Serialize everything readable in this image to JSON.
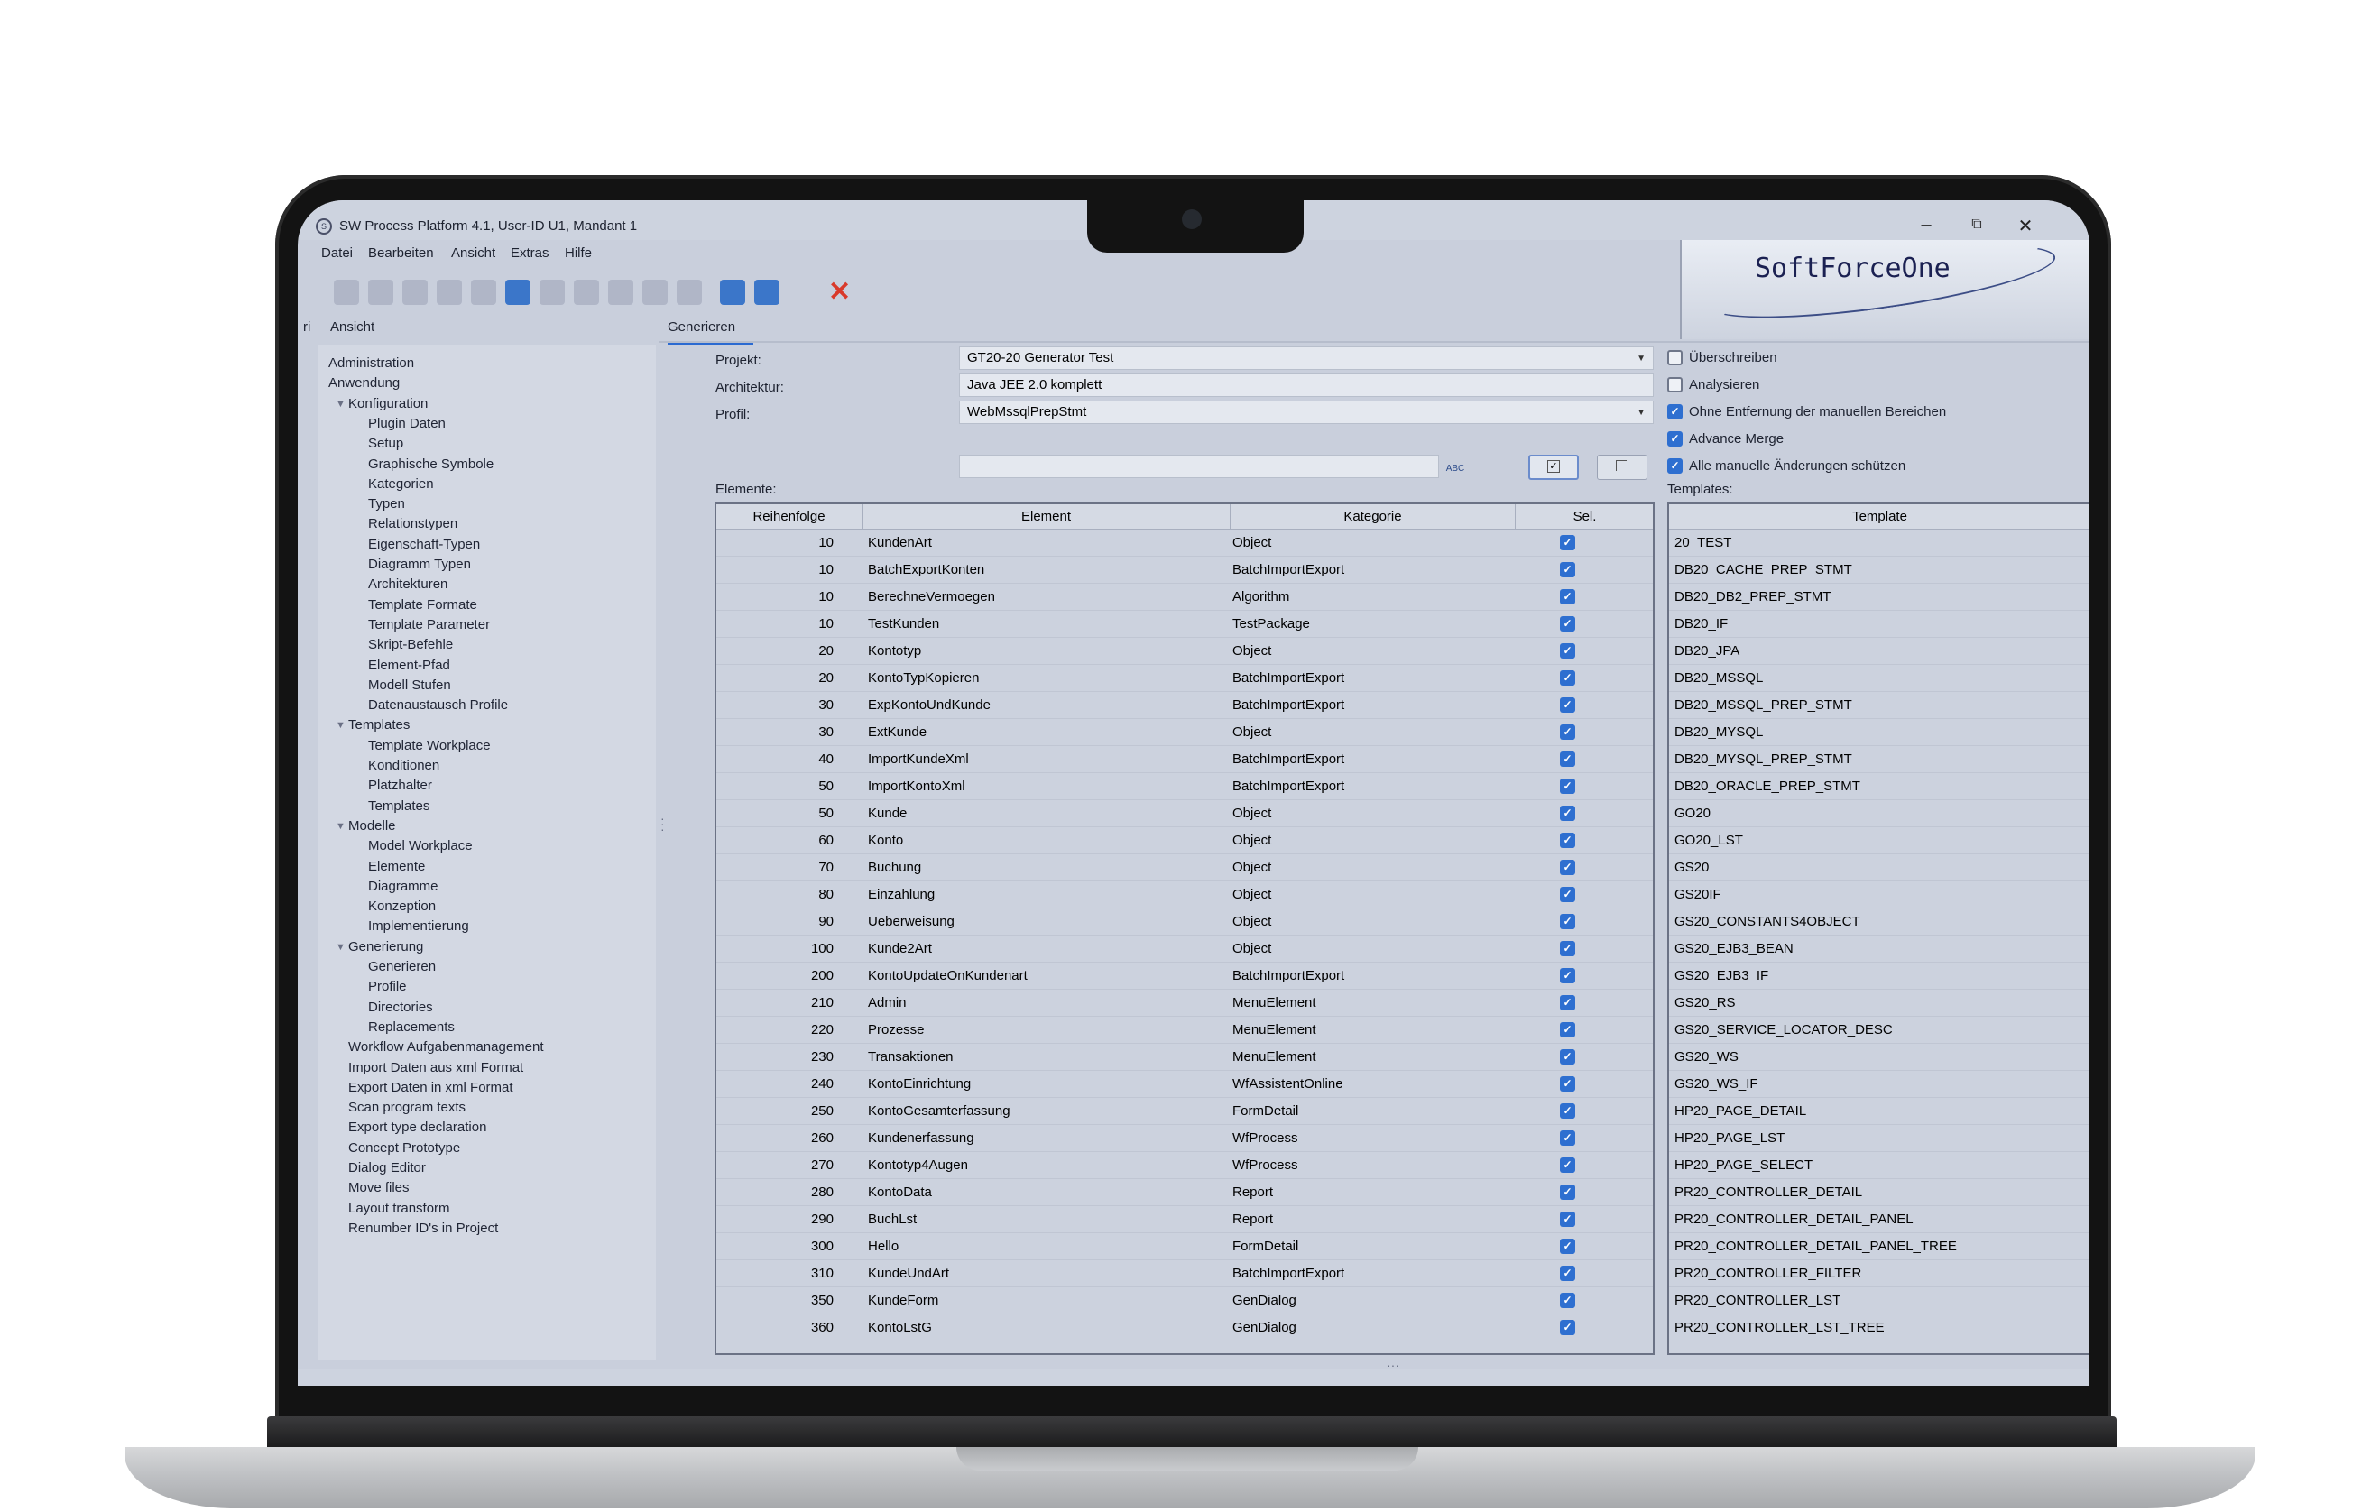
{
  "window": {
    "title": "SW Process Platform 4.1, User-ID U1, Mandant 1",
    "controls": [
      "–",
      "⧉",
      "✕"
    ]
  },
  "menu": [
    "Datei",
    "Bearbeiten",
    "Ansicht",
    "Extras",
    "Hilfe"
  ],
  "logo": "SoftForceOne",
  "left_tabs": [
    "ri",
    "Ansicht"
  ],
  "main_tab": "Generieren",
  "tree": [
    {
      "label": "Administration",
      "level": 0
    },
    {
      "label": "Anwendung",
      "level": 0
    },
    {
      "label": "Konfiguration",
      "level": 1,
      "expanded": true
    },
    {
      "label": "Plugin Daten",
      "level": 2
    },
    {
      "label": "Setup",
      "level": 2
    },
    {
      "label": "Graphische Symbole",
      "level": 2
    },
    {
      "label": "Kategorien",
      "level": 2
    },
    {
      "label": "Typen",
      "level": 2
    },
    {
      "label": "Relationstypen",
      "level": 2
    },
    {
      "label": "Eigenschaft-Typen",
      "level": 2
    },
    {
      "label": "Diagramm Typen",
      "level": 2
    },
    {
      "label": "Architekturen",
      "level": 2
    },
    {
      "label": "Template Formate",
      "level": 2
    },
    {
      "label": "Template Parameter",
      "level": 2
    },
    {
      "label": "Skript-Befehle",
      "level": 2
    },
    {
      "label": "Element-Pfad",
      "level": 2
    },
    {
      "label": "Modell Stufen",
      "level": 2
    },
    {
      "label": "Datenaustausch Profile",
      "level": 2
    },
    {
      "label": "Templates",
      "level": 1,
      "expanded": true
    },
    {
      "label": "Template Workplace",
      "level": 2
    },
    {
      "label": "Konditionen",
      "level": 2
    },
    {
      "label": "Platzhalter",
      "level": 2
    },
    {
      "label": "Templates",
      "level": 2
    },
    {
      "label": "Modelle",
      "level": 1,
      "expanded": true
    },
    {
      "label": "Model Workplace",
      "level": 2
    },
    {
      "label": "Elemente",
      "level": 2
    },
    {
      "label": "Diagramme",
      "level": 2
    },
    {
      "label": "Konzeption",
      "level": 2
    },
    {
      "label": "Implementierung",
      "level": 2
    },
    {
      "label": "Generierung",
      "level": 1,
      "expanded": true
    },
    {
      "label": "Generieren",
      "level": 2
    },
    {
      "label": "Profile",
      "level": 2
    },
    {
      "label": "Directories",
      "level": 2
    },
    {
      "label": "Replacements",
      "level": 2
    },
    {
      "label": "Workflow Aufgabenmanagement",
      "level": 1
    },
    {
      "label": "Import Daten aus xml Format",
      "level": 1
    },
    {
      "label": "Export Daten in xml Format",
      "level": 1
    },
    {
      "label": "Scan program texts",
      "level": 1
    },
    {
      "label": "Export type declaration",
      "level": 1
    },
    {
      "label": "Concept Prototype",
      "level": 1
    },
    {
      "label": "Dialog Editor",
      "level": 1
    },
    {
      "label": "Move files",
      "level": 1
    },
    {
      "label": "Layout transform",
      "level": 1
    },
    {
      "label": "Renumber ID's in Project",
      "level": 1
    }
  ],
  "form": {
    "projekt_label": "Projekt:",
    "projekt_value": "GT20-20 Generator Test",
    "architektur_label": "Architektur:",
    "architektur_value": "Java JEE 2.0 komplett",
    "profil_label": "Profil:",
    "profil_value": "WebMssqlPrepStmt",
    "elemente_label": "Elemente:",
    "templates_label": "Templates:",
    "abc_icon_text": "ABC"
  },
  "options": [
    {
      "label": "Überschreiben",
      "checked": false
    },
    {
      "label": "Analysieren",
      "checked": false
    },
    {
      "label": "Ohne Entfernung der manuellen Bereichen",
      "checked": true
    },
    {
      "label": "Advance Merge",
      "checked": true
    },
    {
      "label": "Alle manuelle Änderungen schützen",
      "checked": true
    }
  ],
  "elements_table": {
    "headers": [
      "Reihenfolge",
      "Element",
      "Kategorie",
      "Sel."
    ],
    "rows": [
      {
        "order": "10",
        "element": "KundenArt",
        "kategorie": "Object",
        "sel": true
      },
      {
        "order": "10",
        "element": "BatchExportKonten",
        "kategorie": "BatchImportExport",
        "sel": true
      },
      {
        "order": "10",
        "element": "BerechneVermoegen",
        "kategorie": "Algorithm",
        "sel": true
      },
      {
        "order": "10",
        "element": "TestKunden",
        "kategorie": "TestPackage",
        "sel": true
      },
      {
        "order": "20",
        "element": "Kontotyp",
        "kategorie": "Object",
        "sel": true
      },
      {
        "order": "20",
        "element": "KontoTypKopieren",
        "kategorie": "BatchImportExport",
        "sel": true
      },
      {
        "order": "30",
        "element": "ExpKontoUndKunde",
        "kategorie": "BatchImportExport",
        "sel": true
      },
      {
        "order": "30",
        "element": "ExtKunde",
        "kategorie": "Object",
        "sel": true
      },
      {
        "order": "40",
        "element": "ImportKundeXml",
        "kategorie": "BatchImportExport",
        "sel": true
      },
      {
        "order": "50",
        "element": "ImportKontoXml",
        "kategorie": "BatchImportExport",
        "sel": true
      },
      {
        "order": "50",
        "element": "Kunde",
        "kategorie": "Object",
        "sel": true
      },
      {
        "order": "60",
        "element": "Konto",
        "kategorie": "Object",
        "sel": true
      },
      {
        "order": "70",
        "element": "Buchung",
        "kategorie": "Object",
        "sel": true
      },
      {
        "order": "80",
        "element": "Einzahlung",
        "kategorie": "Object",
        "sel": true
      },
      {
        "order": "90",
        "element": "Ueberweisung",
        "kategorie": "Object",
        "sel": true
      },
      {
        "order": "100",
        "element": "Kunde2Art",
        "kategorie": "Object",
        "sel": true
      },
      {
        "order": "200",
        "element": "KontoUpdateOnKundenart",
        "kategorie": "BatchImportExport",
        "sel": true
      },
      {
        "order": "210",
        "element": "Admin",
        "kategorie": "MenuElement",
        "sel": true
      },
      {
        "order": "220",
        "element": "Prozesse",
        "kategorie": "MenuElement",
        "sel": true
      },
      {
        "order": "230",
        "element": "Transaktionen",
        "kategorie": "MenuElement",
        "sel": true
      },
      {
        "order": "240",
        "element": "KontoEinrichtung",
        "kategorie": "WfAssistentOnline",
        "sel": true
      },
      {
        "order": "250",
        "element": "KontoGesamterfassung",
        "kategorie": "FormDetail",
        "sel": true
      },
      {
        "order": "260",
        "element": "Kundenerfassung",
        "kategorie": "WfProcess",
        "sel": true
      },
      {
        "order": "270",
        "element": "Kontotyp4Augen",
        "kategorie": "WfProcess",
        "sel": true
      },
      {
        "order": "280",
        "element": "KontoData",
        "kategorie": "Report",
        "sel": true
      },
      {
        "order": "290",
        "element": "BuchLst",
        "kategorie": "Report",
        "sel": true
      },
      {
        "order": "300",
        "element": "Hello",
        "kategorie": "FormDetail",
        "sel": true
      },
      {
        "order": "310",
        "element": "KundeUndArt",
        "kategorie": "BatchImportExport",
        "sel": true
      },
      {
        "order": "350",
        "element": "KundeForm",
        "kategorie": "GenDialog",
        "sel": true
      },
      {
        "order": "360",
        "element": "KontoLstG",
        "kategorie": "GenDialog",
        "sel": true
      }
    ]
  },
  "templates_table": {
    "header": "Template",
    "rows": [
      "20_TEST",
      "DB20_CACHE_PREP_STMT",
      "DB20_DB2_PREP_STMT",
      "DB20_IF",
      "DB20_JPA",
      "DB20_MSSQL",
      "DB20_MSSQL_PREP_STMT",
      "DB20_MYSQL",
      "DB20_MYSQL_PREP_STMT",
      "DB20_ORACLE_PREP_STMT",
      "GO20",
      "GO20_LST",
      "GS20",
      "GS20IF",
      "GS20_CONSTANTS4OBJECT",
      "GS20_EJB3_BEAN",
      "GS20_EJB3_IF",
      "GS20_RS",
      "GS20_SERVICE_LOCATOR_DESC",
      "GS20_WS",
      "GS20_WS_IF",
      "HP20_PAGE_DETAIL",
      "HP20_PAGE_LST",
      "HP20_PAGE_SELECT",
      "PR20_CONTROLLER_DETAIL",
      "PR20_CONTROLLER_DETAIL_PANEL",
      "PR20_CONTROLLER_DETAIL_PANEL_TREE",
      "PR20_CONTROLLER_FILTER",
      "PR20_CONTROLLER_LST",
      "PR20_CONTROLLER_LST_TREE"
    ]
  },
  "colors": {
    "accent": "#2e6fd0",
    "screen_bg": "#c9cfdc",
    "delete": "#d93a2b"
  }
}
